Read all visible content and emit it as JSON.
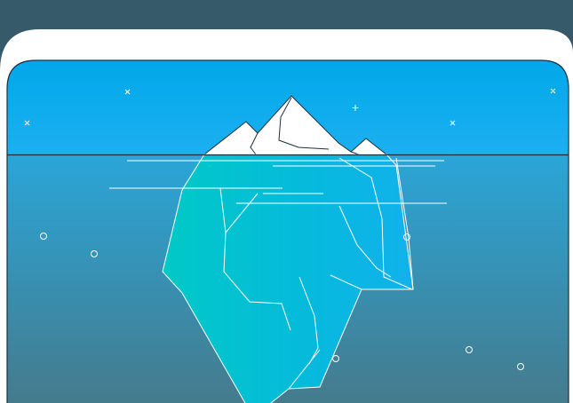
{
  "scene": {
    "background_color": "#375A6B",
    "card_color": "#FFFFFF",
    "sky_color_top": "#00A6E8",
    "sky_color_bottom": "#16AEEF",
    "water_color_top": "#2B9ECE",
    "water_color_bottom": "#3E7F95",
    "iceberg_underwater_colors": [
      "#00C7C9",
      "#0CB4E6"
    ],
    "stroke_color": "#FFFFFF",
    "waterline_color": "#1E2F3A",
    "icons": {
      "sky_marks": [
        "star-x-icon",
        "star-plus-icon"
      ],
      "bubbles": "bubble-icon"
    }
  }
}
